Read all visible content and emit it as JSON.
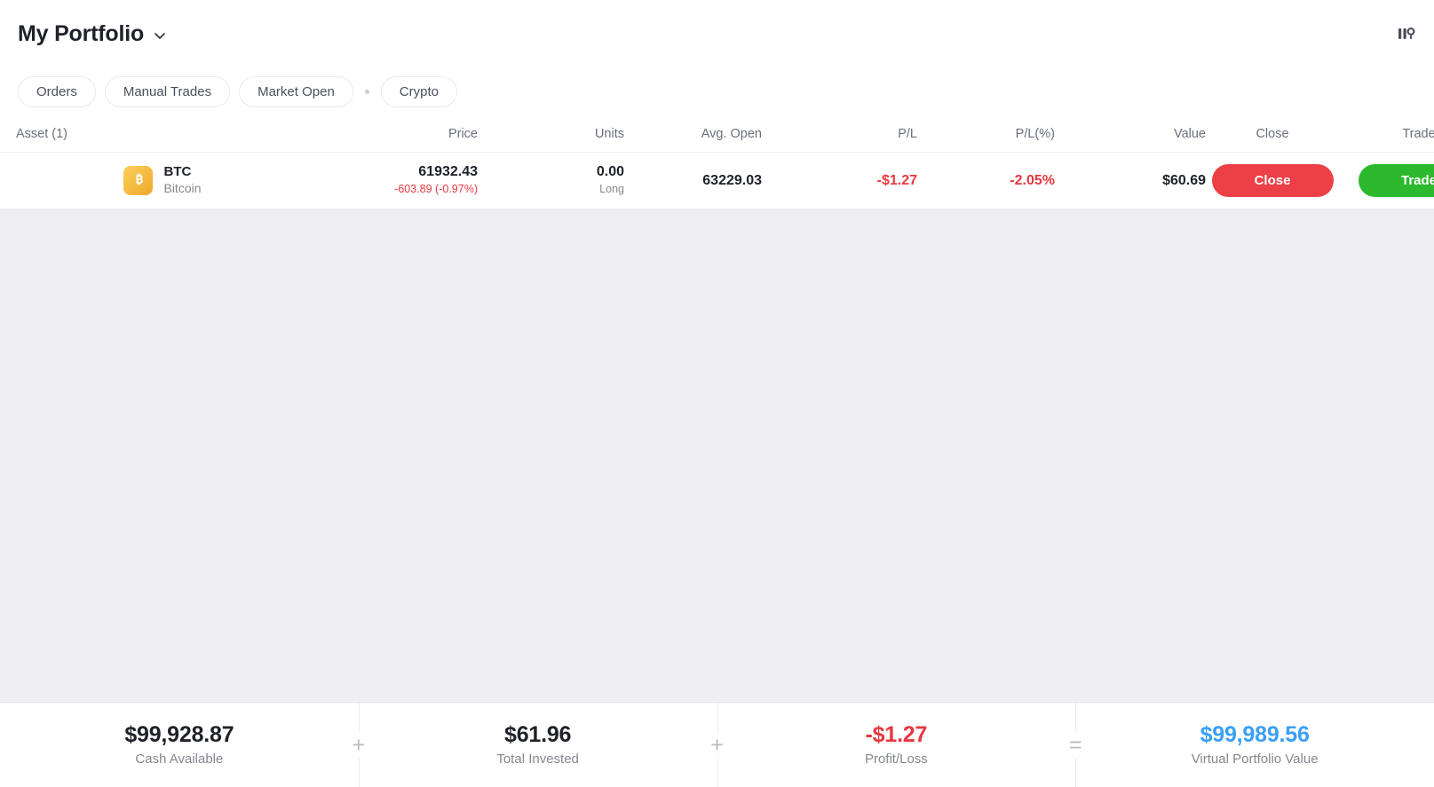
{
  "header": {
    "title": "My Portfolio",
    "dropdown_icon": "chevron-down-icon",
    "columns_icon": "chart-columns-settings-icon"
  },
  "filters": {
    "items": [
      {
        "label": "Orders"
      },
      {
        "label": "Manual Trades"
      },
      {
        "label": "Market Open"
      },
      {
        "label": "Crypto"
      }
    ],
    "separator_after_index": 2
  },
  "table": {
    "columns": [
      {
        "key": "asset",
        "label": "Asset (1)"
      },
      {
        "key": "price",
        "label": "Price"
      },
      {
        "key": "units",
        "label": "Units"
      },
      {
        "key": "avgopen",
        "label": "Avg. Open"
      },
      {
        "key": "pl",
        "label": "P/L"
      },
      {
        "key": "plp",
        "label": "P/L(%)"
      },
      {
        "key": "value",
        "label": "Value"
      },
      {
        "key": "close",
        "label": "Close"
      },
      {
        "key": "trade",
        "label": "Trade"
      }
    ],
    "rows": [
      {
        "icon": "bitcoin-icon",
        "symbol": "BTC",
        "name": "Bitcoin",
        "price": "61932.43",
        "price_change": "-603.89 (-0.97%)",
        "units": "0.00",
        "direction": "Long",
        "avg_open": "63229.03",
        "pl": "-$1.27",
        "pl_percent": "-2.05%",
        "value": "$60.69",
        "close_label": "Close",
        "trade_label": "Trade",
        "menu_icon": "kebab-menu-icon"
      }
    ]
  },
  "summary": {
    "cells": [
      {
        "value": "$99,928.87",
        "label": "Cash Available",
        "tone": "default"
      },
      {
        "value": "$61.96",
        "label": "Total Invested",
        "tone": "default"
      },
      {
        "value": "-$1.27",
        "label": "Profit/Loss",
        "tone": "negative"
      },
      {
        "value": "$99,989.56",
        "label": "Virtual Portfolio Value",
        "tone": "accent"
      }
    ],
    "operators": [
      "+",
      "+",
      "="
    ]
  },
  "colors": {
    "negative": "#e8373f",
    "accent": "#3a9ff5",
    "close_button": "#ec3f46",
    "trade_button": "#2db92d",
    "body_background": "#efeff1"
  }
}
